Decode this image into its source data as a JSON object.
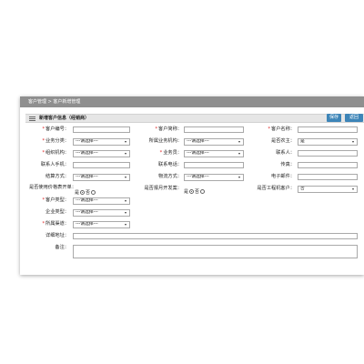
{
  "breadcrumb": "客户管理 > 客户新增管理",
  "section_title": "新增客户信息（经销商）",
  "buttons": {
    "save": "保存",
    "back": "返回"
  },
  "placeholder_option": "---请选择---",
  "labels": {
    "customer_no": "客户编号：",
    "customer_short": "客户简称：",
    "customer_name": "客户名称：",
    "biz_category": "业务分类：",
    "biz_org": "所属业务机构：",
    "is_dealer": "是否农主：",
    "org": "组织机构：",
    "salesman": "业务员：",
    "contact": "联系人：",
    "contact_phone": "联系人手机：",
    "contact_tel": "联系电话：",
    "fax": "传真：",
    "settle_method": "结算方式：",
    "logistics_method": "物流方式：",
    "email": "电子邮件：",
    "use_price_form": "是否使用价格表开单：",
    "reported_project": "是否报月开发案：",
    "is_project_customer": "是否工程机客户：",
    "customer_type": "客户类型：",
    "business_type": "企业类型：",
    "channel": "所属渠道：",
    "address": "详细地址：",
    "remark": "备注："
  },
  "values": {
    "is_dealer": "是",
    "is_project_customer": "否"
  },
  "radio": {
    "yes": "是",
    "no": "否"
  }
}
